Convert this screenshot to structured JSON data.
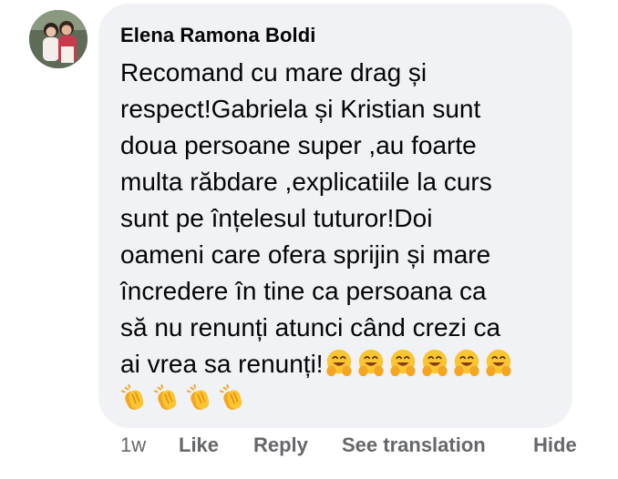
{
  "comment": {
    "author": "Elena Ramona Boldi",
    "lines": [
      "Recomand cu mare drag și",
      "respect!Gabriela și Kristian sunt",
      "doua persoane super ,au foarte",
      "multa răbdare ,explicatiile la curs",
      "sunt pe înțelesul tuturor!Doi",
      "oameni care ofera sprijin și mare",
      "încredere în tine ca persoana ca",
      "să nu renunți atunci când crezi ca",
      "ai vrea sa renunți!"
    ],
    "inline_emojis": [
      "hugging-face-emoji",
      "hugging-face-emoji",
      "hugging-face-emoji",
      "hugging-face-emoji",
      "hugging-face-emoji",
      "hugging-face-emoji"
    ],
    "emoji_row": [
      "clapping-hands-emoji",
      "clapping-hands-emoji",
      "clapping-hands-emoji",
      "clapping-hands-emoji"
    ]
  },
  "actions": {
    "time": "1w",
    "like": "Like",
    "reply": "Reply",
    "see_translation": "See translation",
    "hide": "Hide"
  },
  "colors": {
    "bubble": "#f0f2f5",
    "text": "#050505",
    "secondary_text": "#65676b",
    "emoji_yellow": "#fbc531"
  }
}
